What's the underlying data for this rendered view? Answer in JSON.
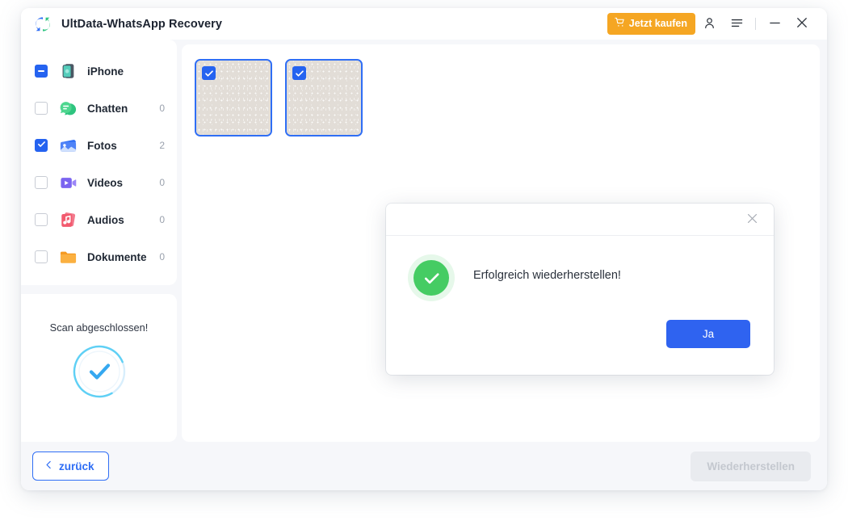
{
  "window": {
    "title": "UltData-WhatsApp Recovery",
    "logo_icon": "circular-refresh-logo"
  },
  "titlebar": {
    "buy_label": "Jetzt kaufen",
    "buy_icon": "cart-icon",
    "buy_color": "#f5a623",
    "account_icon": "person-icon",
    "menu_icon": "menu-icon",
    "minimize_icon": "minimize-icon",
    "close_icon": "close-icon"
  },
  "sidebar": {
    "items": [
      {
        "label": "iPhone",
        "count": "",
        "icon": "iphone-icon",
        "checkbox": "indeterminate",
        "active": false
      },
      {
        "label": "Chatten",
        "count": "0",
        "icon": "chat-icon",
        "checkbox": "unchecked",
        "active": false
      },
      {
        "label": "Fotos",
        "count": "2",
        "icon": "photo-icon",
        "checkbox": "checked",
        "active": true
      },
      {
        "label": "Videos",
        "count": "0",
        "icon": "video-icon",
        "checkbox": "unchecked",
        "active": false
      },
      {
        "label": "Audios",
        "count": "0",
        "icon": "audio-icon",
        "checkbox": "unchecked",
        "active": false
      },
      {
        "label": "Dokumente",
        "count": "0",
        "icon": "folder-icon",
        "checkbox": "unchecked",
        "active": false
      }
    ],
    "scan": {
      "status_text": "Scan abgeschlossen!",
      "icon": "check-ring-icon",
      "accent_color": "#35a8f0"
    }
  },
  "main": {
    "thumbnails": [
      {
        "name": "photo-thumbnail-1",
        "selected": true
      },
      {
        "name": "photo-thumbnail-2",
        "selected": true
      }
    ]
  },
  "footer": {
    "back_label": "zurück",
    "back_icon": "chevron-left-icon",
    "recover_label": "Wiederherstellen",
    "recover_disabled": true
  },
  "modal": {
    "message": "Erfolgreich wiederherstellen!",
    "ok_label": "Ja",
    "close_icon": "close-icon",
    "status_icon": "success-check-icon",
    "status_color": "#45cc63",
    "accent_color": "#2f63f0"
  }
}
